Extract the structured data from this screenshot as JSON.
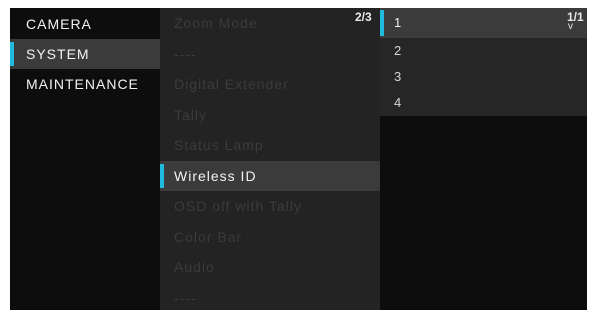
{
  "left_menu": {
    "items": [
      {
        "label": "CAMERA"
      },
      {
        "label": "SYSTEM"
      },
      {
        "label": "MAINTENANCE"
      }
    ],
    "selected_index": 1
  },
  "mid_menu": {
    "page_indicator": "2/3",
    "items": [
      {
        "label": "Zoom Mode"
      },
      {
        "label": "----"
      },
      {
        "label": "Digital Extender"
      },
      {
        "label": "Tally"
      },
      {
        "label": "Status Lamp"
      },
      {
        "label": "Wireless ID"
      },
      {
        "label": "OSD off with Tally"
      },
      {
        "label": "Color Bar"
      },
      {
        "label": "Audio"
      },
      {
        "label": "----"
      }
    ],
    "selected_index": 5
  },
  "right_menu": {
    "page_indicator": "1/1",
    "caret": "v",
    "items": [
      {
        "label": "1"
      },
      {
        "label": "2"
      },
      {
        "label": "3"
      },
      {
        "label": "4"
      }
    ],
    "selected_index": 0
  },
  "colors": {
    "accent": "#22b9df",
    "selected_bg": "#3b3b3b",
    "panel_bg": "#232323",
    "screen_bg": "#0d0d0d",
    "disabled_text": "#3b3b3b"
  }
}
